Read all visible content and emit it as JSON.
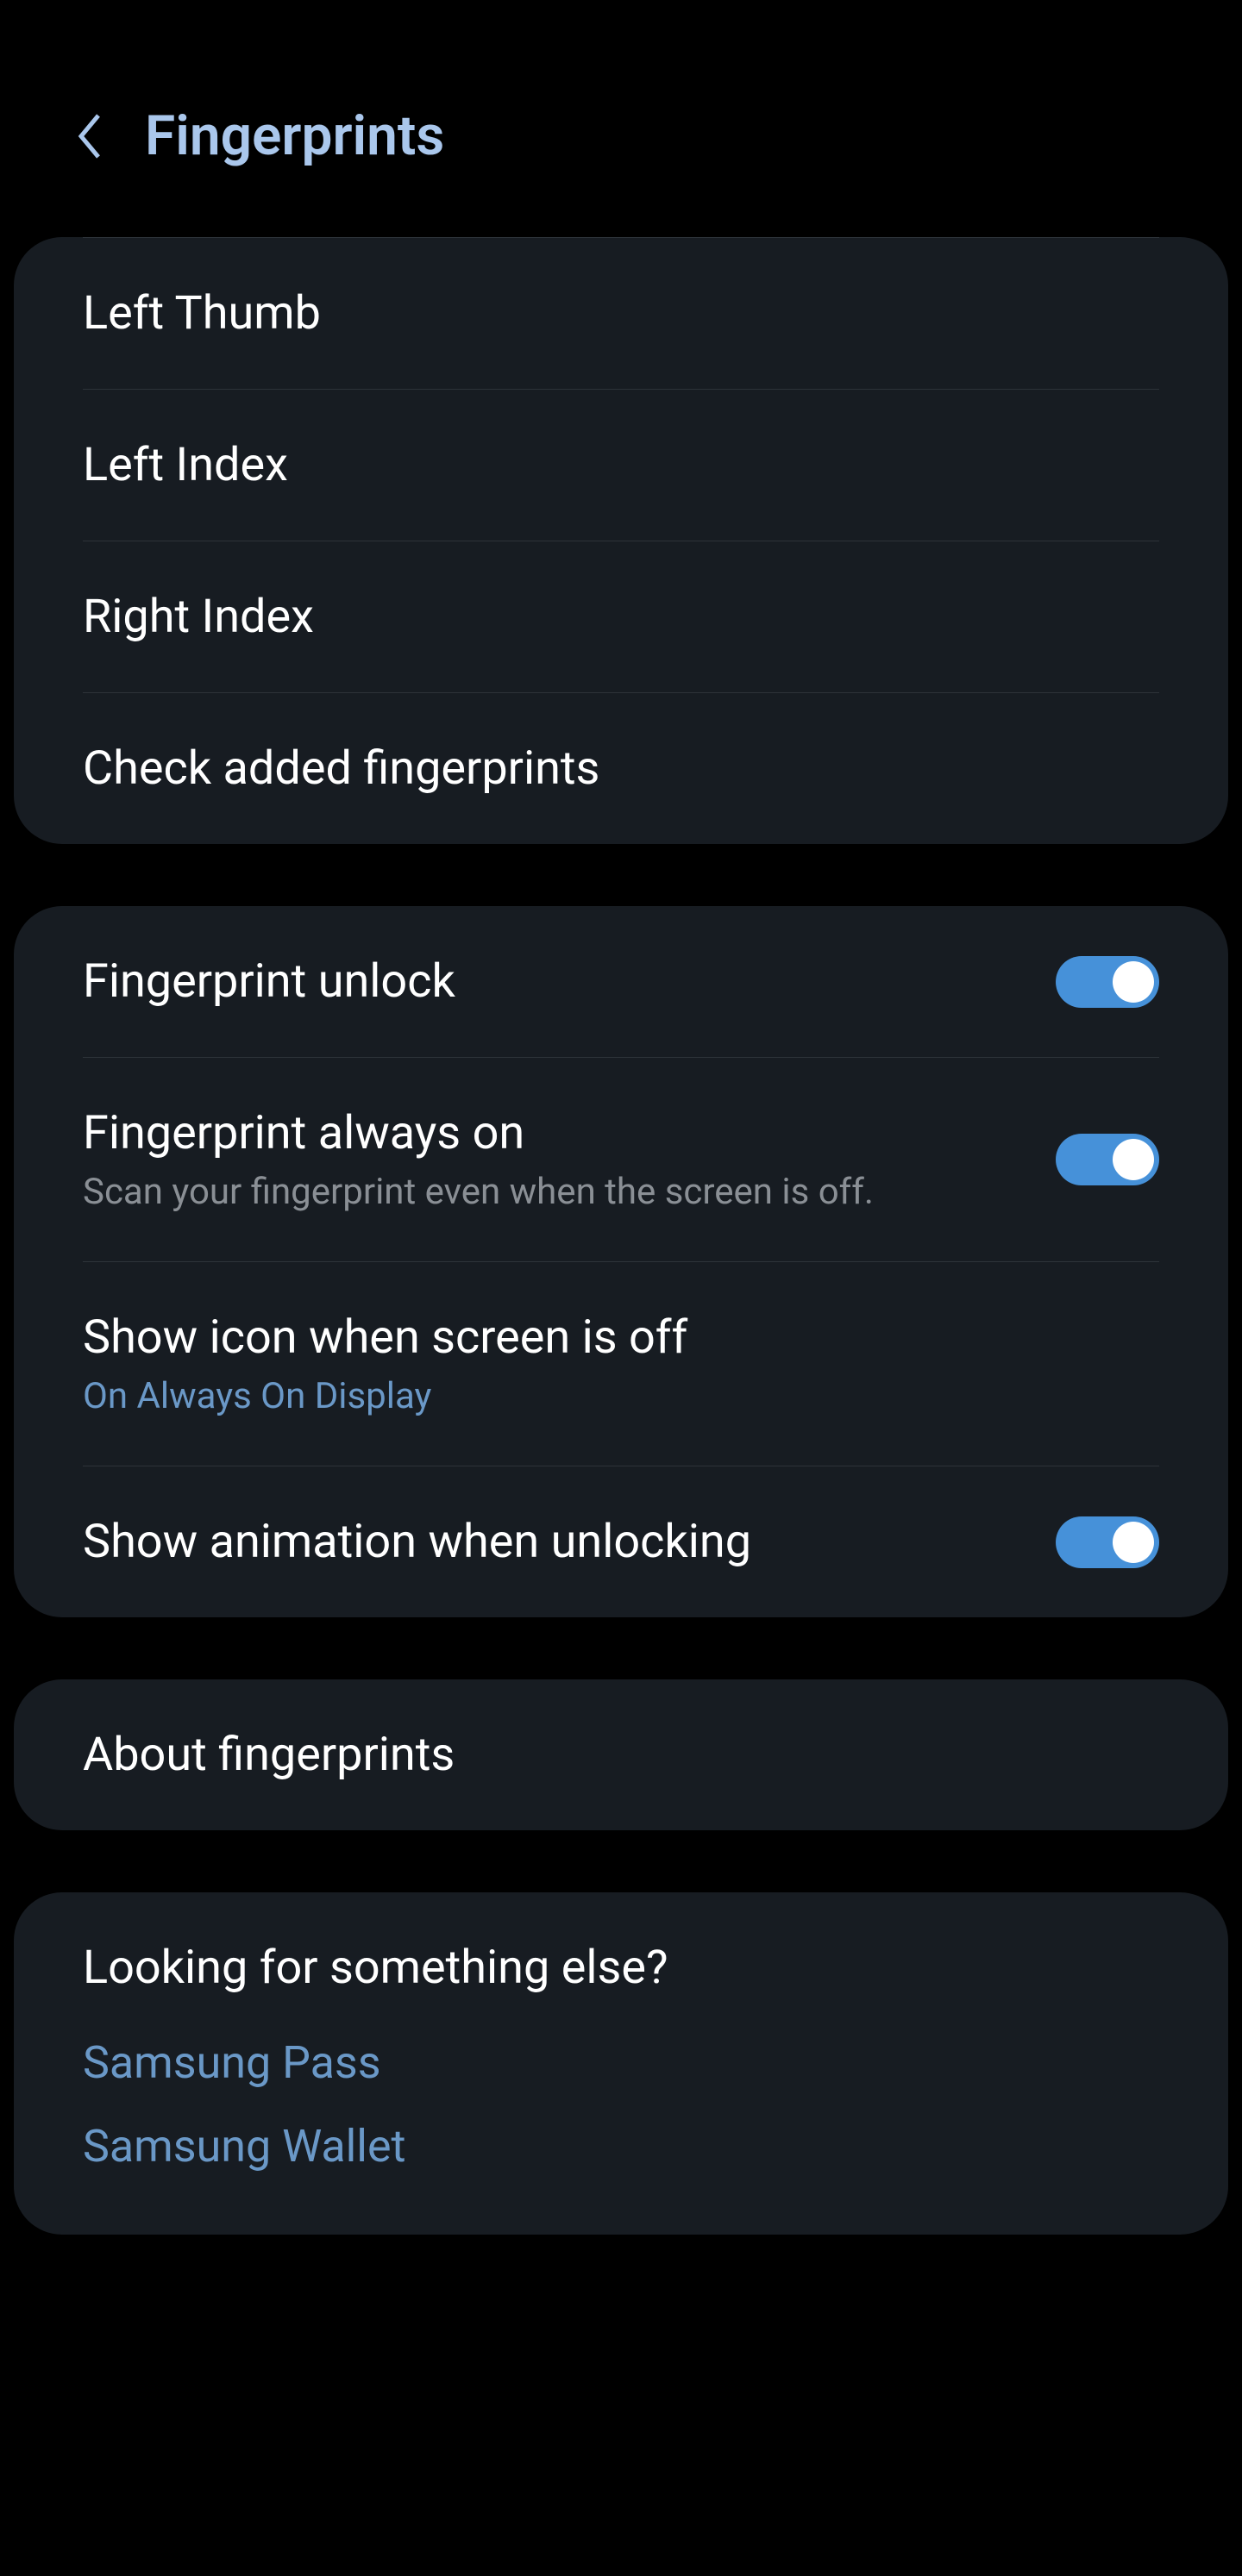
{
  "header": {
    "title": "Fingerprints"
  },
  "fingerprints": {
    "items": [
      {
        "label": "Left Thumb"
      },
      {
        "label": "Left Index"
      },
      {
        "label": "Right Index"
      }
    ],
    "check_label": "Check added fingerprints"
  },
  "settings": {
    "unlock": {
      "label": "Fingerprint unlock"
    },
    "always_on": {
      "label": "Fingerprint always on",
      "subtitle": "Scan your fingerprint even when the screen is off."
    },
    "show_icon": {
      "label": "Show icon when screen is off",
      "value": "On Always On Display"
    },
    "animation": {
      "label": "Show animation when unlocking"
    }
  },
  "about": {
    "label": "About fingerprints"
  },
  "footer": {
    "heading": "Looking for something else?",
    "links": [
      {
        "label": "Samsung Pass"
      },
      {
        "label": "Samsung Wallet"
      }
    ]
  }
}
